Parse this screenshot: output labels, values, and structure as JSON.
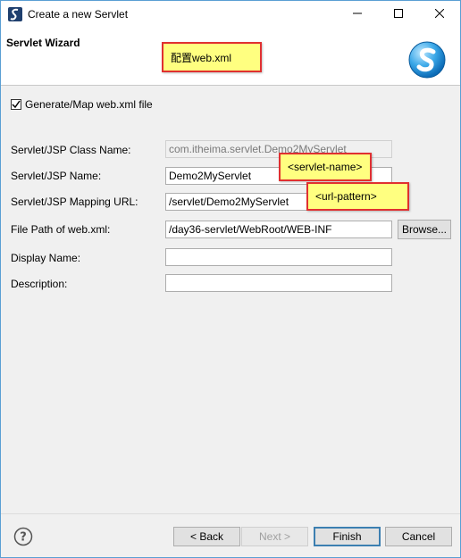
{
  "window": {
    "title": "Create a new Servlet"
  },
  "banner": {
    "title": "Servlet Wizard"
  },
  "notes": {
    "config": "配置web.xml",
    "servlet_name": "<servlet-name>",
    "url_pattern": "<url-pattern>"
  },
  "form": {
    "generate_checkbox_label": "Generate/Map web.xml file",
    "generate_checked": true,
    "fields": {
      "class_name": {
        "label": "Servlet/JSP Class Name:",
        "value": "com.itheima.servlet.Demo2MyServlet"
      },
      "name": {
        "label": "Servlet/JSP Name:",
        "value": "Demo2MyServlet"
      },
      "mapping_url": {
        "label": "Servlet/JSP Mapping URL:",
        "value": "/servlet/Demo2MyServlet"
      },
      "file_path": {
        "label": "File Path of web.xml:",
        "value": "/day36-servlet/WebRoot/WEB-INF"
      },
      "display_name": {
        "label": "Display Name:",
        "value": ""
      },
      "description": {
        "label": "Description:",
        "value": ""
      }
    },
    "browse_label": "Browse..."
  },
  "buttons": {
    "back": "< Back",
    "next": "Next >",
    "finish": "Finish",
    "cancel": "Cancel"
  },
  "colors": {
    "note_fill": "#ffff80",
    "note_border": "#e03030",
    "default_button_border": "#3c7fb1"
  }
}
